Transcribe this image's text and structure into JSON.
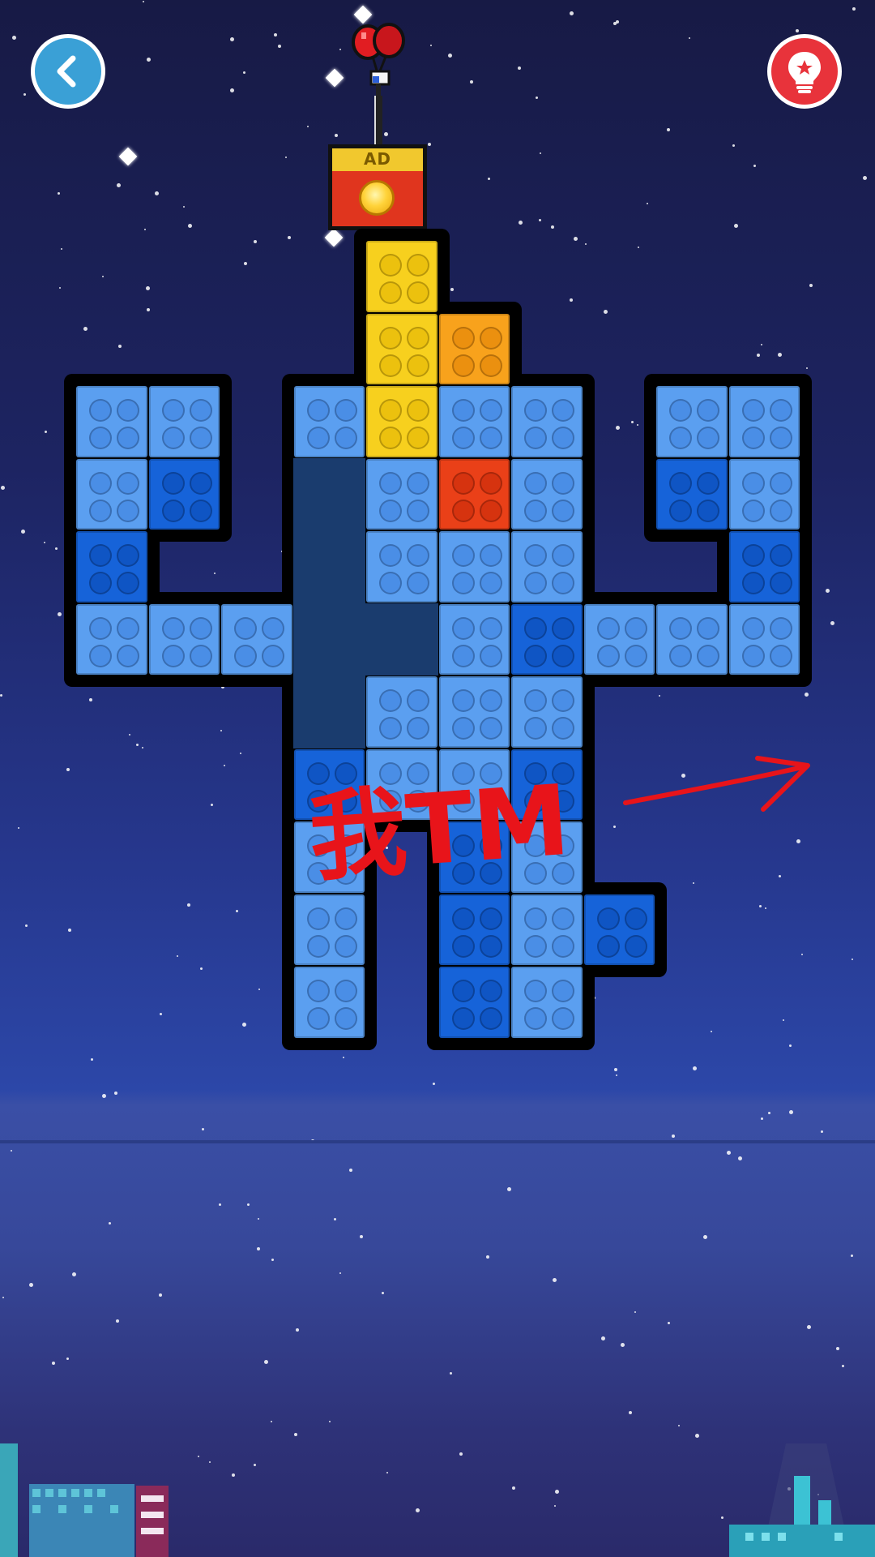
{
  "header": {
    "back_icon": "chevron-left-icon",
    "hint_icon": "lightbulb-icon",
    "colors": {
      "back": "#3aa0d6",
      "hint": "#e8333b"
    }
  },
  "ad_box": {
    "label": "AD",
    "icon": "coin-icon"
  },
  "annotation": {
    "text": "我TM",
    "color": "#e8141a",
    "shape": "arrow-right"
  },
  "board": {
    "colors": {
      "light": "#5b9ff0",
      "dark": "#1663d9",
      "yellow": "#f7d01e",
      "orange": "#f8a21c",
      "red": "#ea4018",
      "empty": "#1a3c6e"
    }
  }
}
